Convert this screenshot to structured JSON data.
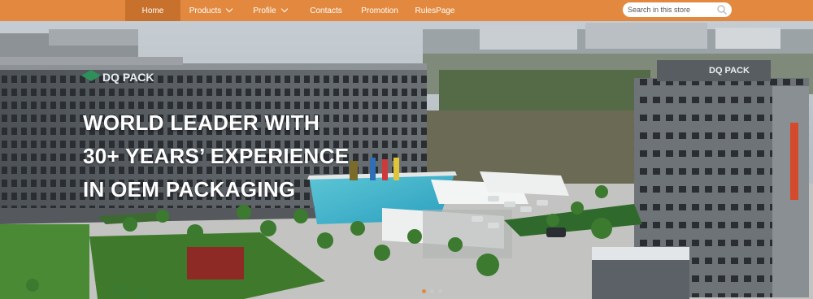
{
  "nav": {
    "items": [
      {
        "label": "Home",
        "active": true,
        "dropdown": false
      },
      {
        "label": "Products",
        "active": false,
        "dropdown": true
      },
      {
        "label": "Profile",
        "active": false,
        "dropdown": true
      },
      {
        "label": "Contacts",
        "active": false,
        "dropdown": false
      },
      {
        "label": "Promotion",
        "active": false,
        "dropdown": false
      },
      {
        "label": "RulesPage",
        "active": false,
        "dropdown": false
      }
    ]
  },
  "search": {
    "placeholder": "Search in this store",
    "icon": "search-icon"
  },
  "hero": {
    "headline_lines": [
      "WORLD LEADER WITH",
      "30+ YEARS’ EXPERIENCE",
      "IN OEM PACKAGING"
    ],
    "signs": [
      "DQ PACK",
      "DQ PACK"
    ],
    "slides": {
      "count": 3,
      "active_index": 0
    }
  },
  "colors": {
    "accent": "#e3893f",
    "active_nav": "#c8712d"
  }
}
